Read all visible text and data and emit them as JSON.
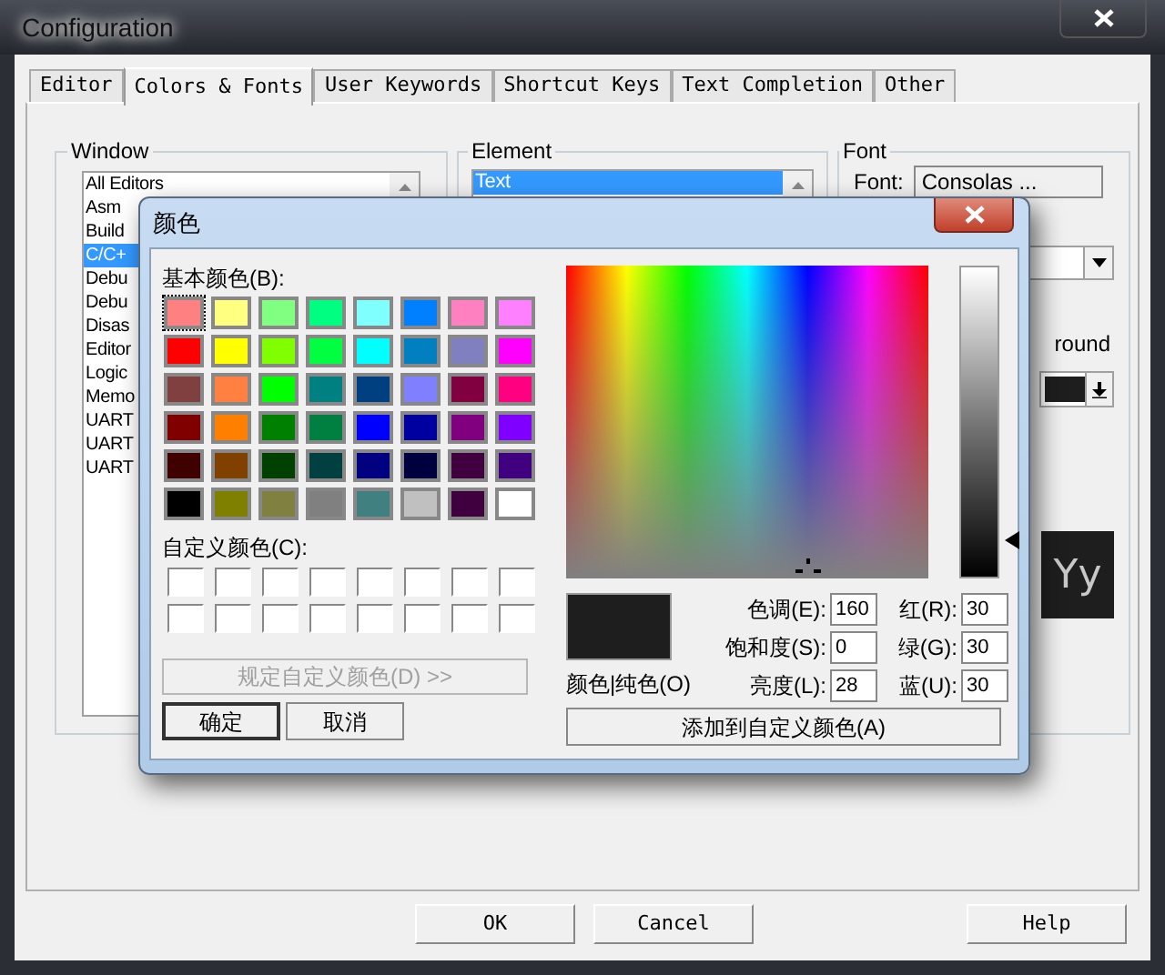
{
  "window": {
    "title": "Configuration"
  },
  "tabs": [
    {
      "label": "Editor",
      "selected": false
    },
    {
      "label": "Colors & Fonts",
      "selected": true
    },
    {
      "label": "User Keywords",
      "selected": false
    },
    {
      "label": "Shortcut Keys",
      "selected": false
    },
    {
      "label": "Text Completion",
      "selected": false
    },
    {
      "label": "Other",
      "selected": false
    }
  ],
  "window_group": {
    "title": "Window",
    "items": [
      {
        "label": "All Editors",
        "selected": false
      },
      {
        "label": "Asm",
        "selected": false
      },
      {
        "label": "Build",
        "selected": false
      },
      {
        "label": "C/C+",
        "selected": true
      },
      {
        "label": "Debu",
        "selected": false
      },
      {
        "label": "Debu",
        "selected": false
      },
      {
        "label": "Disas",
        "selected": false
      },
      {
        "label": "Editor",
        "selected": false
      },
      {
        "label": "Logic",
        "selected": false
      },
      {
        "label": "Memo",
        "selected": false
      },
      {
        "label": "UART",
        "selected": false
      },
      {
        "label": "UART",
        "selected": false
      },
      {
        "label": "UART",
        "selected": false
      }
    ]
  },
  "element_group": {
    "title": "Element",
    "items": [
      {
        "label": "Text",
        "selected": true
      }
    ]
  },
  "font_group": {
    "title": "Font",
    "font_label": "Font:",
    "font_button": "Consolas ...",
    "background_label": "round",
    "color_swatch": {
      "color": "#1e1e1e"
    },
    "preview": "Yy"
  },
  "buttons": [
    "OK",
    "Cancel",
    "Help"
  ],
  "color_dialog": {
    "title": "颜色",
    "basic_label": "基本颜色(B):",
    "basic_colors": [
      {
        "color": "#ff8080",
        "selected": true
      },
      {
        "color": "#ffff80",
        "selected": false
      },
      {
        "color": "#80ff80",
        "selected": false
      },
      {
        "color": "#00ff80",
        "selected": false
      },
      {
        "color": "#80ffff",
        "selected": false
      },
      {
        "color": "#0080ff",
        "selected": false
      },
      {
        "color": "#ff80c0",
        "selected": false
      },
      {
        "color": "#ff80ff",
        "selected": false
      },
      {
        "color": "#ff0000",
        "selected": false
      },
      {
        "color": "#ffff00",
        "selected": false
      },
      {
        "color": "#80ff00",
        "selected": false
      },
      {
        "color": "#00ff40",
        "selected": false
      },
      {
        "color": "#00ffff",
        "selected": false
      },
      {
        "color": "#0080c0",
        "selected": false
      },
      {
        "color": "#8080c0",
        "selected": false
      },
      {
        "color": "#ff00ff",
        "selected": false
      },
      {
        "color": "#804040",
        "selected": false
      },
      {
        "color": "#ff8040",
        "selected": false
      },
      {
        "color": "#00ff00",
        "selected": false
      },
      {
        "color": "#008080",
        "selected": false
      },
      {
        "color": "#004080",
        "selected": false
      },
      {
        "color": "#8080ff",
        "selected": false
      },
      {
        "color": "#800040",
        "selected": false
      },
      {
        "color": "#ff0080",
        "selected": false
      },
      {
        "color": "#800000",
        "selected": false
      },
      {
        "color": "#ff8000",
        "selected": false
      },
      {
        "color": "#008000",
        "selected": false
      },
      {
        "color": "#008040",
        "selected": false
      },
      {
        "color": "#0000ff",
        "selected": false
      },
      {
        "color": "#0000a0",
        "selected": false
      },
      {
        "color": "#800080",
        "selected": false
      },
      {
        "color": "#8000ff",
        "selected": false
      },
      {
        "color": "#400000",
        "selected": false
      },
      {
        "color": "#804000",
        "selected": false
      },
      {
        "color": "#004000",
        "selected": false
      },
      {
        "color": "#004040",
        "selected": false
      },
      {
        "color": "#000080",
        "selected": false
      },
      {
        "color": "#000040",
        "selected": false
      },
      {
        "color": "#400040",
        "selected": false
      },
      {
        "color": "#400080",
        "selected": false
      },
      {
        "color": "#000000",
        "selected": false
      },
      {
        "color": "#808000",
        "selected": false
      },
      {
        "color": "#808040",
        "selected": false
      },
      {
        "color": "#808080",
        "selected": false
      },
      {
        "color": "#408080",
        "selected": false
      },
      {
        "color": "#c0c0c0",
        "selected": false
      },
      {
        "color": "#400040",
        "selected": false
      },
      {
        "color": "#ffffff",
        "selected": false
      }
    ],
    "custom_label": "自定义颜色(C):",
    "custom_colors": [
      {
        "color": "#ffffff"
      },
      {
        "color": "#ffffff"
      },
      {
        "color": "#ffffff"
      },
      {
        "color": "#ffffff"
      },
      {
        "color": "#ffffff"
      },
      {
        "color": "#ffffff"
      },
      {
        "color": "#ffffff"
      },
      {
        "color": "#ffffff"
      },
      {
        "color": "#ffffff"
      },
      {
        "color": "#ffffff"
      },
      {
        "color": "#ffffff"
      },
      {
        "color": "#ffffff"
      },
      {
        "color": "#ffffff"
      },
      {
        "color": "#ffffff"
      },
      {
        "color": "#ffffff"
      },
      {
        "color": "#ffffff"
      }
    ],
    "define_button": {
      "label": "规定自定义颜色(D) >>",
      "disabled": true
    },
    "ok_button": "确定",
    "cancel_button": "取消",
    "luminance": {
      "level": 0.12
    },
    "preview": {
      "color": "#1e1e1e",
      "label": "颜色|纯色(O)"
    },
    "fields": [
      {
        "label": "色调(E):",
        "value": "160"
      },
      {
        "label": "红(R):",
        "value": "30"
      },
      {
        "label": "饱和度(S):",
        "value": "0"
      },
      {
        "label": "绿(G):",
        "value": "30"
      },
      {
        "label": "亮度(L):",
        "value": "28"
      },
      {
        "label": "蓝(U):",
        "value": "30"
      }
    ],
    "add_button": "添加到自定义颜色(A)"
  }
}
